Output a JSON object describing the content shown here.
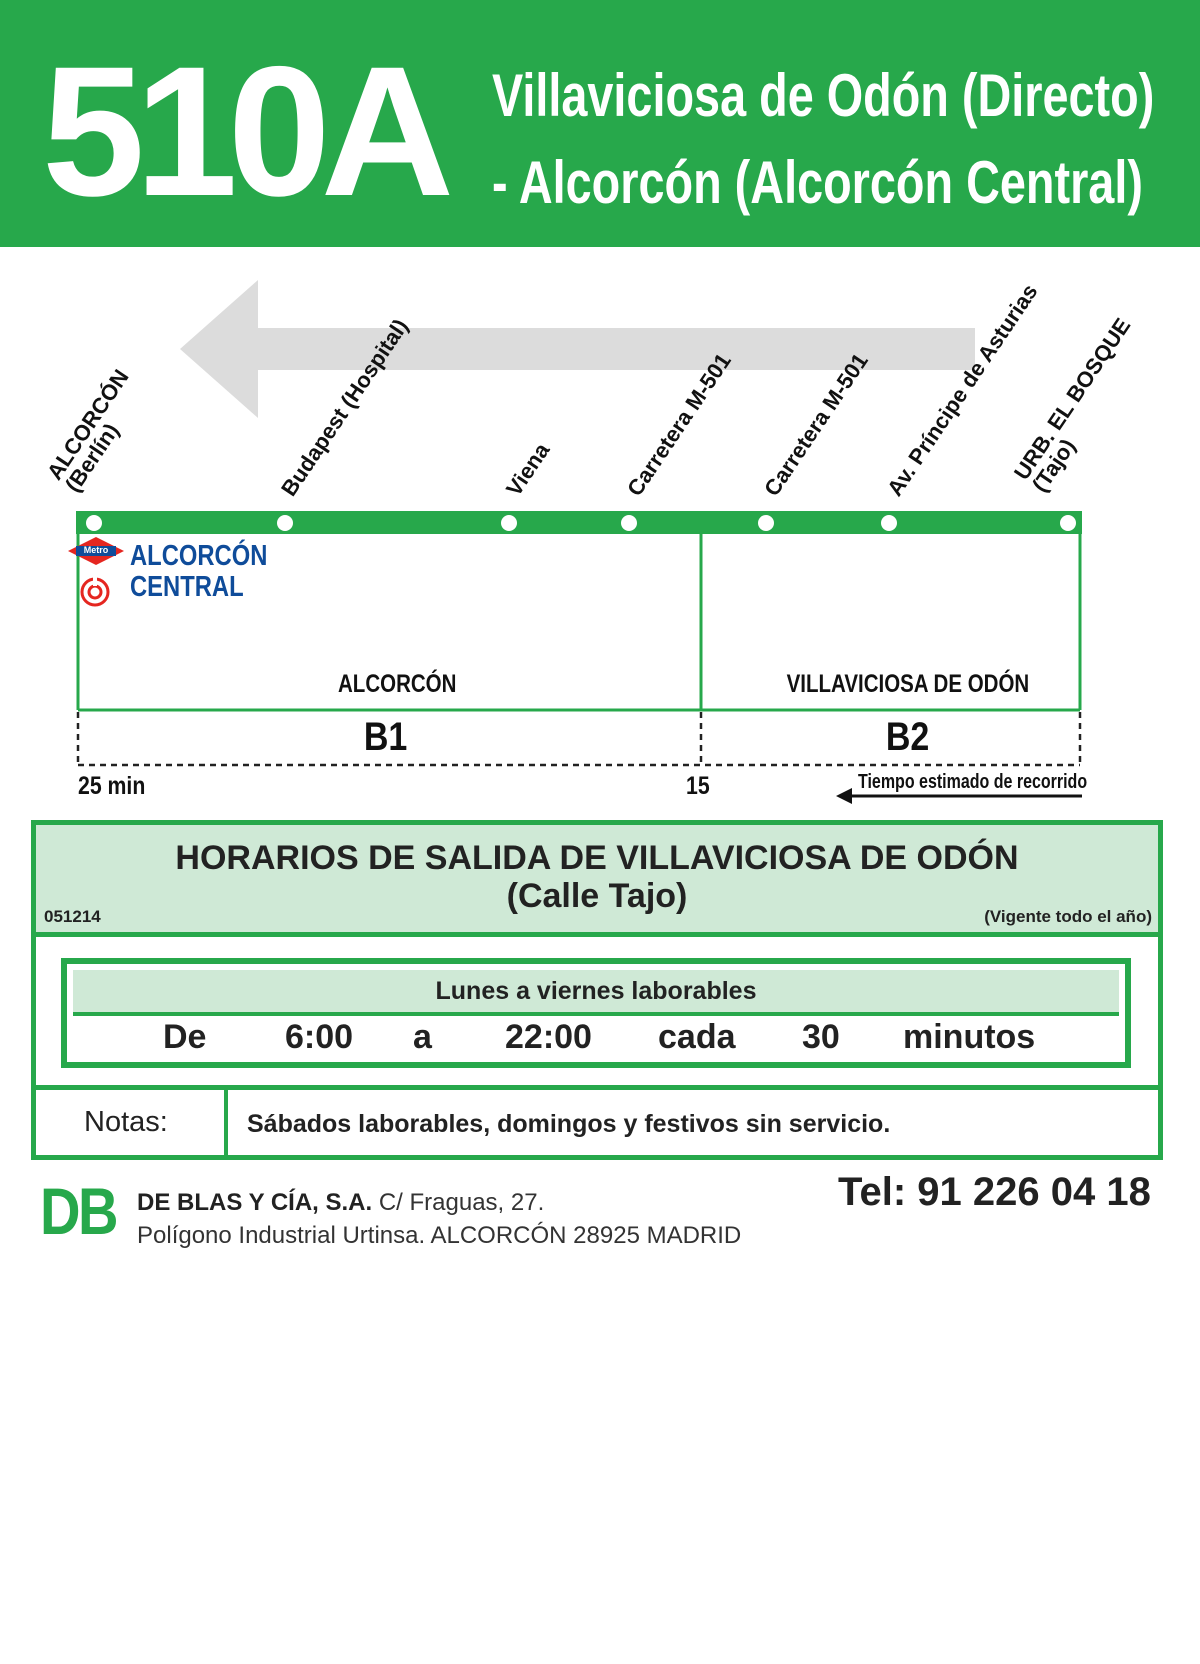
{
  "colors": {
    "brand_green": "#27a84b",
    "light_green": "#cfe9d6",
    "arrow_gray": "#dcdcdc",
    "station_blue": "#0f4c9a",
    "metro_red": "#e52620"
  },
  "header": {
    "route_number": "510A",
    "line1": "Villaviciosa de Odón (Directo)",
    "line2": "- Alcorcón (Alcorcón Central)"
  },
  "route": {
    "stops": [
      {
        "name": "ALCORCÓN",
        "sub": "(Berlín)"
      },
      {
        "name": "Budapest (Hospital)",
        "sub": ""
      },
      {
        "name": "Viena",
        "sub": ""
      },
      {
        "name": "Carretera M-501",
        "sub": ""
      },
      {
        "name": "Carretera M-501",
        "sub": ""
      },
      {
        "name": "Av. Príncipe de Asturias",
        "sub": ""
      },
      {
        "name": "URB. EL BOSQUE",
        "sub": "(Tajo)"
      }
    ],
    "metro_label": "Metro",
    "station": "ALCORCÓN\nCENTRAL",
    "zones": [
      {
        "name": "ALCORCÓN",
        "code": "B1",
        "time": "25 min"
      },
      {
        "name": "VILLAVICIOSA DE ODÓN",
        "code": "B2",
        "time": "15"
      }
    ],
    "time_legend": "Tiempo estimado de recorrido"
  },
  "schedule": {
    "title_line1": "HORARIOS DE SALIDA DE VILLAVICIOSA DE ODÓN",
    "title_line2": "(Calle Tajo)",
    "code": "051214",
    "validity": "(Vigente todo el año)",
    "day_type": "Lunes a viernes laborables",
    "frequency": {
      "from_word": "De",
      "start": "6:00",
      "to_word": "a",
      "end": "22:00",
      "every_word": "cada",
      "interval": "30",
      "unit": "minutos"
    },
    "notes_label": "Notas:",
    "notes_text": "Sábados laborables, domingos y festivos sin servicio."
  },
  "footer": {
    "logo": "DB",
    "company_name": "DE BLAS Y CÍA, S.A.",
    "address_line1": "C/ Fraguas, 27.",
    "address_line2": "Polígono Industrial Urtinsa. ALCORCÓN 28925 MADRID",
    "phone": "Tel: 91 226 04 18"
  }
}
